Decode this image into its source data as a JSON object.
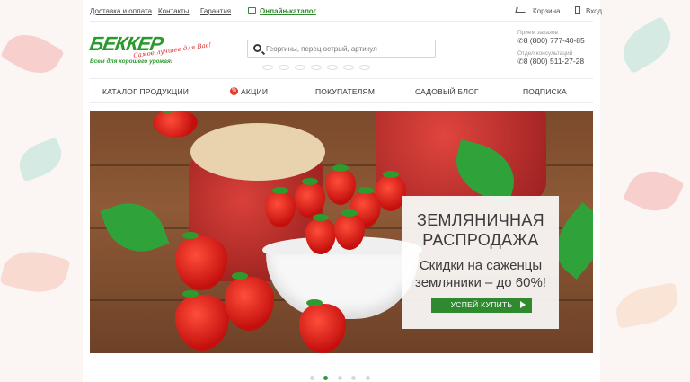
{
  "topbar": {
    "delivery_link": "Доставка и оплата",
    "contacts_link": "Контакты",
    "warranty_link": "Гарантия",
    "online_catalog_link": "Онлайн-каталог",
    "cart_label": "Корзина",
    "login_label": "Вход"
  },
  "logo": {
    "brand": "БЕККЕР",
    "slogan": "Самое лучшее для Вас!",
    "tagline": "Всем для хорошего урожая!"
  },
  "search": {
    "placeholder": "Георгины, перец острый, артикул"
  },
  "contacts": {
    "orders_label": "Прием заказов",
    "orders_phone": "8 (800) 777-40-85",
    "consult_label": "Отдел консультаций",
    "consult_phone": "8 (800) 511-27-28"
  },
  "nav": {
    "items": [
      {
        "label": "КАТАЛОГ ПРОДУКЦИИ"
      },
      {
        "label": "АКЦИИ"
      },
      {
        "label": "ПОКУПАТЕЛЯМ"
      },
      {
        "label": "САДОВЫЙ БЛОГ"
      },
      {
        "label": "ПОДПИСКА"
      }
    ]
  },
  "hero": {
    "title_line1": "ЗЕМЛЯНИЧНАЯ",
    "title_line2": "РАСПРОДАЖА",
    "subtitle_line1": "Скидки на саженцы",
    "subtitle_line2": "земляники – до 60%!",
    "cta_label": "УСПЕЙ КУПИТЬ",
    "slides_total": 5,
    "active_slide": 2
  },
  "colors": {
    "brand_green": "#2f8a2f",
    "accent_red": "#e23b2c"
  }
}
